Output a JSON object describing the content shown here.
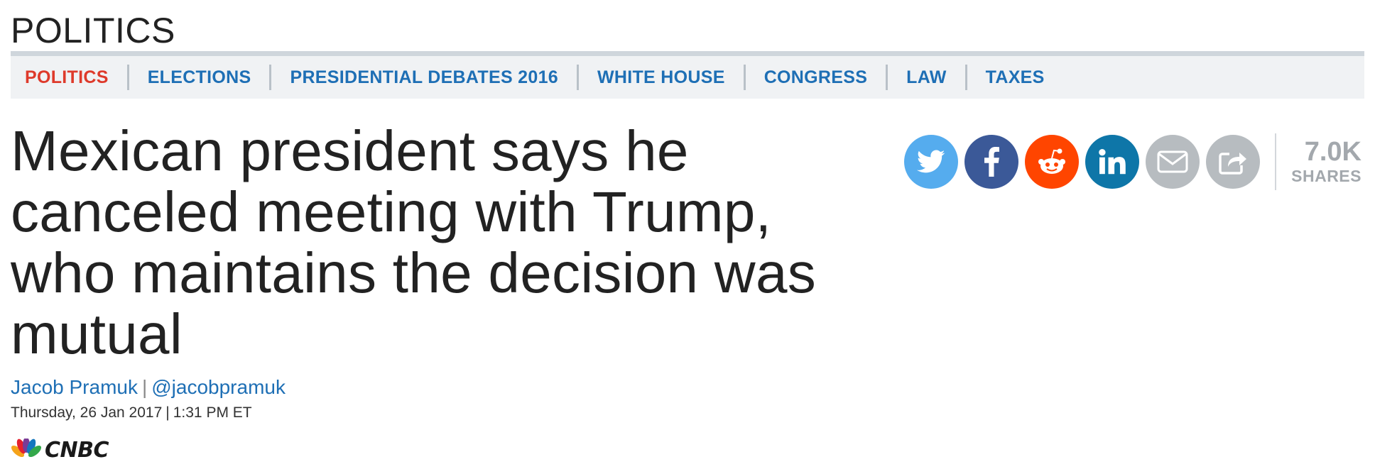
{
  "section": {
    "title": "POLITICS"
  },
  "nav": {
    "items": [
      {
        "label": "POLITICS",
        "active": true
      },
      {
        "label": "ELECTIONS"
      },
      {
        "label": "PRESIDENTIAL DEBATES 2016"
      },
      {
        "label": "WHITE HOUSE"
      },
      {
        "label": "CONGRESS"
      },
      {
        "label": "LAW"
      },
      {
        "label": "TAXES"
      }
    ]
  },
  "article": {
    "headline": "Mexican president says he canceled meeting with Trump, who maintains the decision was mutual",
    "author": "Jacob Pramuk",
    "byline_separator": "|",
    "twitter_handle": "@jacobpramuk",
    "date": "Thursday, 26 Jan 2017",
    "date_separator": "|",
    "time": "1:31 PM ET"
  },
  "brand": {
    "name": "CNBC"
  },
  "share": {
    "buttons": [
      {
        "icon": "twitter-icon",
        "color": "#55acee"
      },
      {
        "icon": "facebook-icon",
        "color": "#3b5998"
      },
      {
        "icon": "reddit-icon",
        "color": "#ff4500"
      },
      {
        "icon": "linkedin-icon",
        "color": "#0e76a8"
      },
      {
        "icon": "email-icon",
        "color": "#b7bcc0"
      },
      {
        "icon": "share-icon",
        "color": "#b7bcc0"
      }
    ],
    "count": "7.0K",
    "count_label": "SHARES"
  },
  "colors": {
    "accent_red": "#de3a2b",
    "link_blue": "#1e6fb5",
    "nav_background": "#f0f2f4"
  }
}
